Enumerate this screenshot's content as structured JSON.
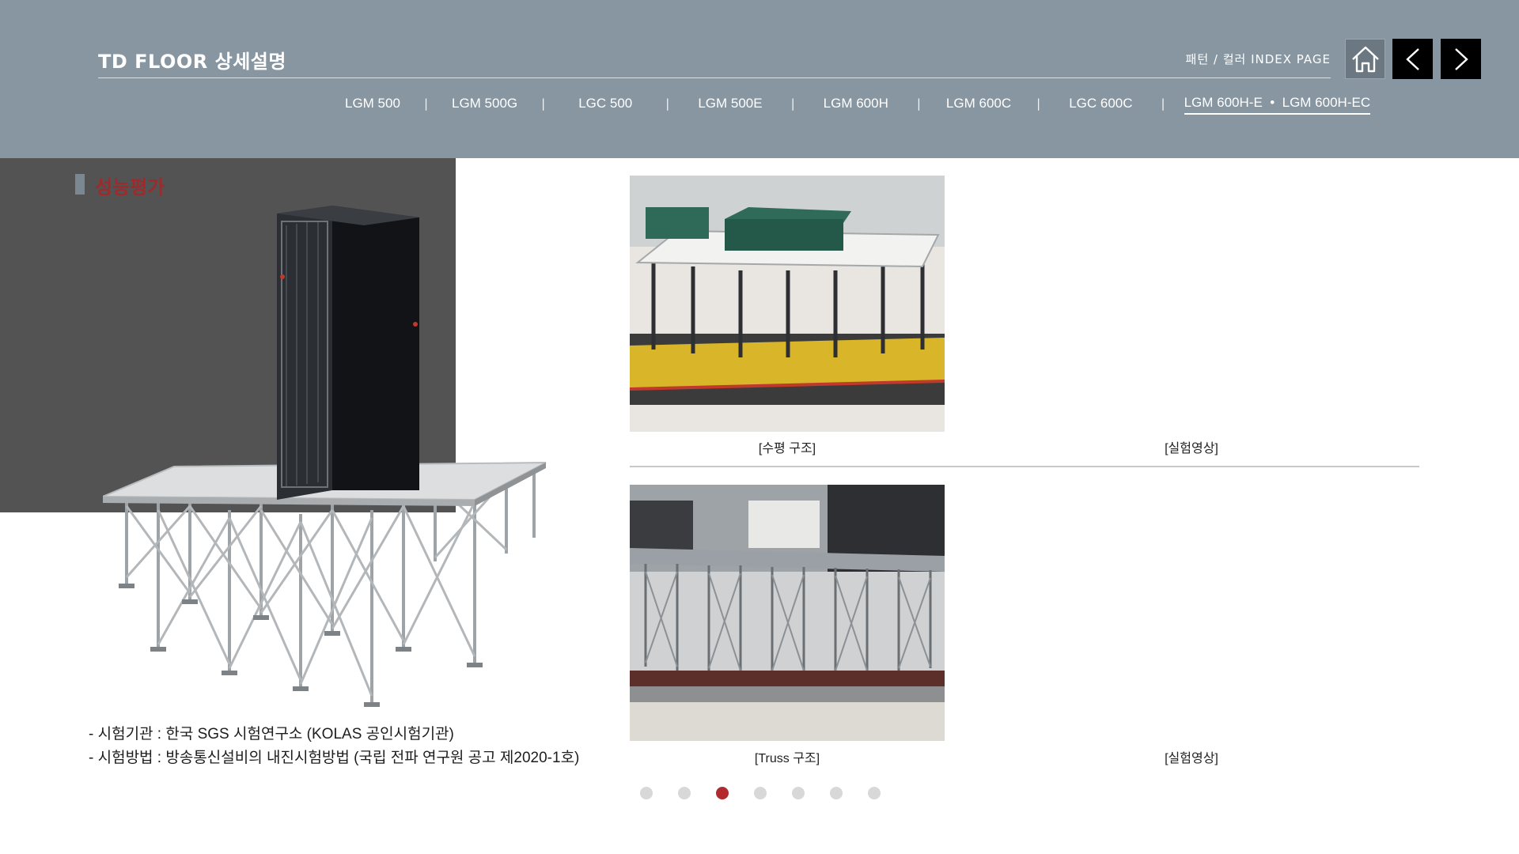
{
  "header": {
    "title": "TD FLOOR 상세설명",
    "index_link": "패턴 / 컬러 INDEX PAGE",
    "nav": {
      "home_icon": "home-icon",
      "prev_icon": "chevron-left-icon",
      "next_icon": "chevron-right-icon"
    },
    "tabs": [
      {
        "label": "LGM 500"
      },
      {
        "label": "LGM 500G"
      },
      {
        "label": "LGC 500"
      },
      {
        "label": "LGM 500E"
      },
      {
        "label": "LGM 600H"
      },
      {
        "label": "LGM 600C"
      },
      {
        "label": "LGC 600C"
      },
      {
        "label": "LGM 600H-E  •  LGM 600H-EC",
        "active": true
      }
    ],
    "tab_separator": "|"
  },
  "section": {
    "title": "성능평가"
  },
  "info": {
    "line1": "- 시험기관 : 한국 SGS 시험연구소 (KOLAS 공인시험기관)",
    "line2": "- 시험방법 : 방송통신설비의 내진시험방법 (국립 전파 연구원 공고 제2020-1호)"
  },
  "media": {
    "caption_horizontal": "[수평 구조]",
    "caption_video_top": "[실험영상]",
    "caption_truss": "[Truss 구조]",
    "caption_video_bottom": "[실험영상]"
  },
  "pagination": {
    "total": 7,
    "active_index": 2
  },
  "colors": {
    "header_bg": "#8796a1",
    "accent_red": "#9e2a2b",
    "dot_active": "#b22a2e",
    "video_placeholder": "#545354"
  }
}
